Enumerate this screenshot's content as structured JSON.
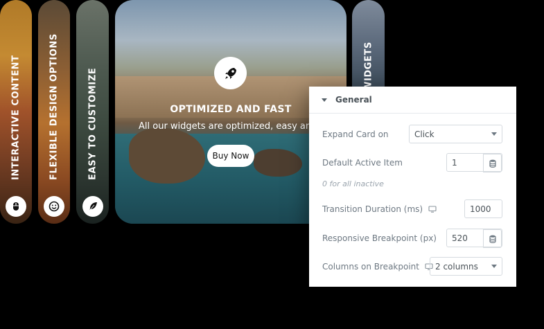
{
  "cards": [
    {
      "label": "INTERACTIVE CONTENT",
      "icon": "mouse-icon"
    },
    {
      "label": "FLEXIBLE DESIGN OPTIONS",
      "icon": "smiley-icon"
    },
    {
      "label": "EASY TO CUSTOMIZE",
      "icon": "feather-icon"
    },
    {
      "label": "WIDGETS",
      "icon": ""
    }
  ],
  "expanded_card": {
    "icon": "rocket-icon",
    "title": "OPTIMIZED AND FAST",
    "description": "All our widgets are optimized, easy and fa",
    "button_label": "Buy Now"
  },
  "panel": {
    "section_title": "General",
    "expand_card_on": {
      "label": "Expand Card on",
      "value": "Click"
    },
    "default_active_item": {
      "label": "Default Active Item",
      "value": "1",
      "hint": "0 for all inactive"
    },
    "transition_duration": {
      "label": "Transition Duration (ms)",
      "value": "1000"
    },
    "responsive_breakpoint": {
      "label": "Responsive Breakpoint (px)",
      "value": "520"
    },
    "columns_on_breakpoint": {
      "label": "Columns on Breakpoint",
      "value": "2 columns"
    }
  }
}
